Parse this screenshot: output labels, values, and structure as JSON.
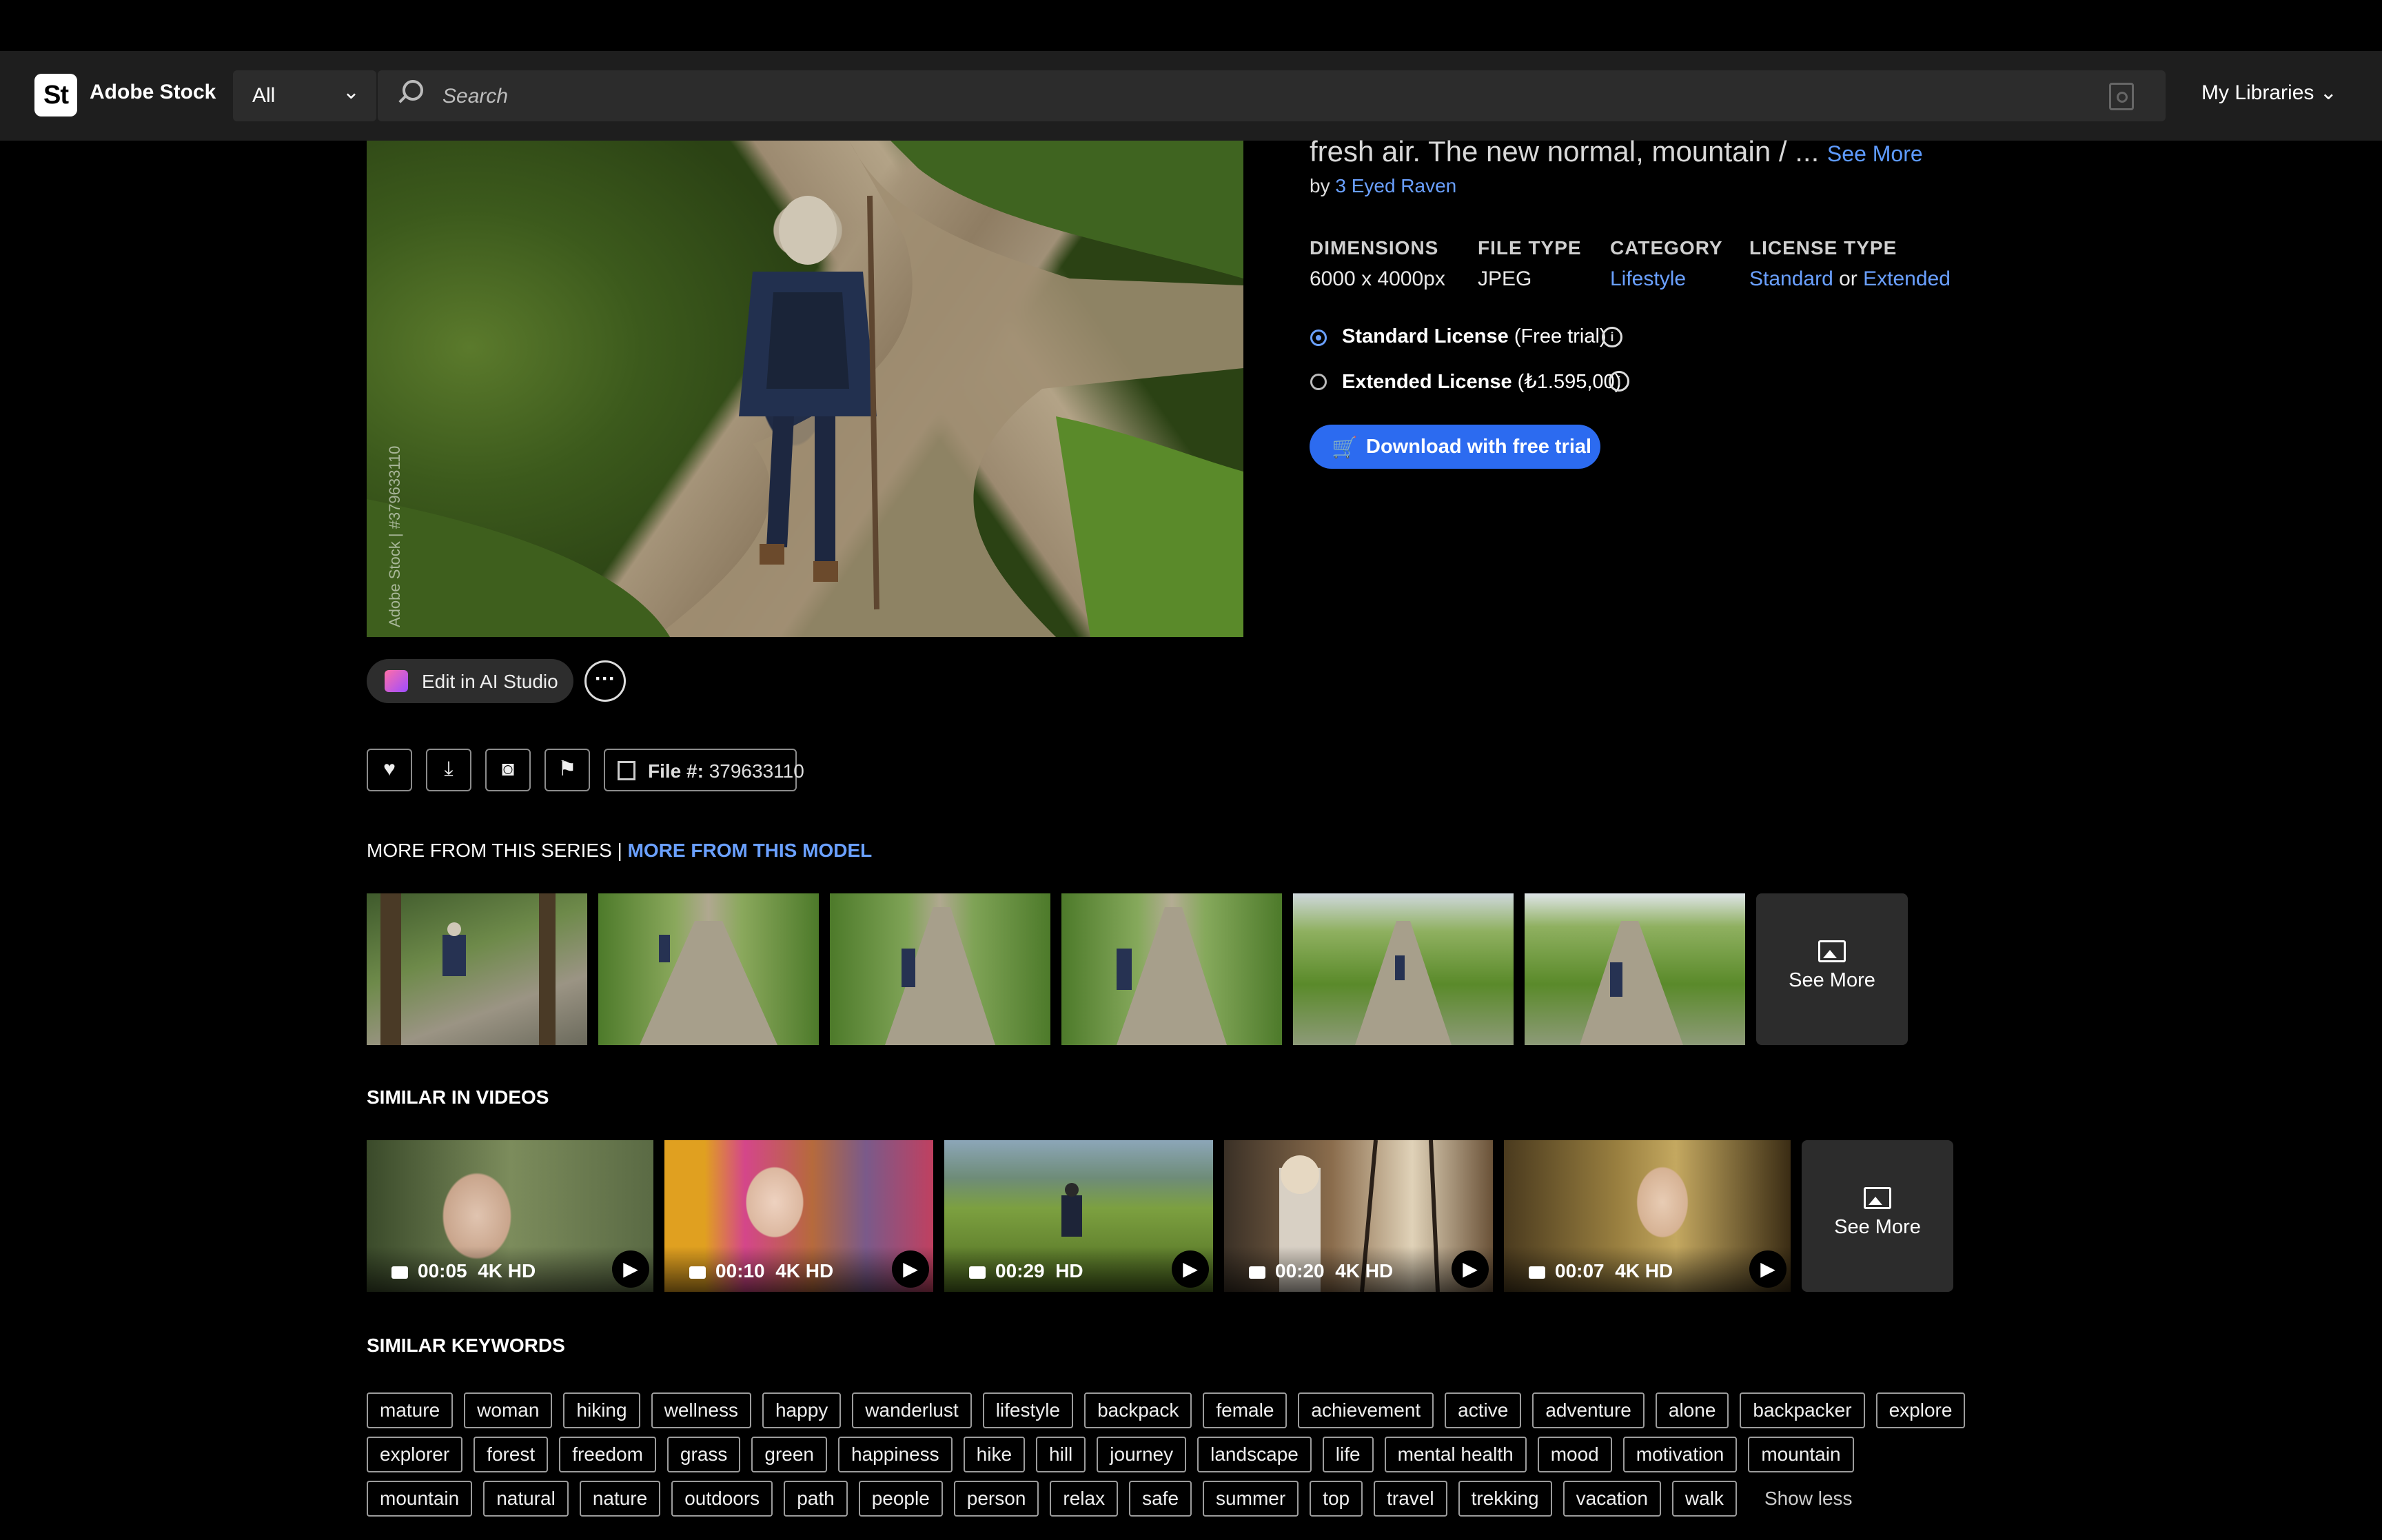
{
  "header": {
    "logo": "St",
    "brand": "Adobe Stock",
    "scope": "All",
    "search_placeholder": "Search",
    "my_libraries": "My Libraries"
  },
  "asset": {
    "title_tail": "fresh air. The new normal, mountain / ...",
    "see_more": "See More",
    "by": "by",
    "author": "3 Eyed Raven",
    "watermark": "Adobe Stock | #379633110",
    "meta": {
      "dimensions_label": "DIMENSIONS",
      "dimensions_value": "6000 x 4000px",
      "file_type_label": "FILE TYPE",
      "file_type_value": "JPEG",
      "category_label": "CATEGORY",
      "category_value": "Lifestyle",
      "license_type_label": "LICENSE TYPE",
      "license_standard": "Standard",
      "license_or": "or",
      "license_extended": "Extended"
    },
    "licenses": {
      "standard_name": "Standard License",
      "standard_note": "(Free trial)",
      "extended_name": "Extended License",
      "extended_note": "(₺1.595,00)"
    },
    "download_button": "Download with free trial",
    "edit_ai_button": "Edit in AI Studio",
    "file_label": "File #:",
    "file_number": "379633110"
  },
  "series": {
    "label_series": "MORE FROM THIS SERIES",
    "separator": "|",
    "label_model": "MORE FROM THIS MODEL",
    "see_more": "See More"
  },
  "videos": {
    "heading": "SIMILAR IN VIDEOS",
    "items": [
      {
        "duration": "00:05",
        "quality": "4K  HD"
      },
      {
        "duration": "00:10",
        "quality": "4K  HD"
      },
      {
        "duration": "00:29",
        "quality": "HD"
      },
      {
        "duration": "00:20",
        "quality": "4K  HD"
      },
      {
        "duration": "00:07",
        "quality": "4K  HD"
      }
    ],
    "see_more": "See More"
  },
  "keywords": {
    "heading": "SIMILAR KEYWORDS",
    "rows": [
      [
        "mature",
        "woman",
        "hiking",
        "wellness",
        "happy",
        "wanderlust",
        "lifestyle",
        "backpack",
        "female",
        "achievement",
        "active",
        "adventure",
        "alone",
        "backpacker",
        "explore"
      ],
      [
        "explorer",
        "forest",
        "freedom",
        "grass",
        "green",
        "happiness",
        "hike",
        "hill",
        "journey",
        "landscape",
        "life",
        "mental health",
        "mood",
        "motivation",
        "mountain"
      ],
      [
        "mountain",
        "natural",
        "nature",
        "outdoors",
        "path",
        "people",
        "person",
        "relax",
        "safe",
        "summer",
        "top",
        "travel",
        "trekking",
        "vacation",
        "walk"
      ]
    ],
    "show_less": "Show less"
  },
  "colors": {
    "accent": "#2c6bf0",
    "link": "#6aa0ff",
    "bg": "#000000",
    "bar": "#1e1e1e"
  }
}
